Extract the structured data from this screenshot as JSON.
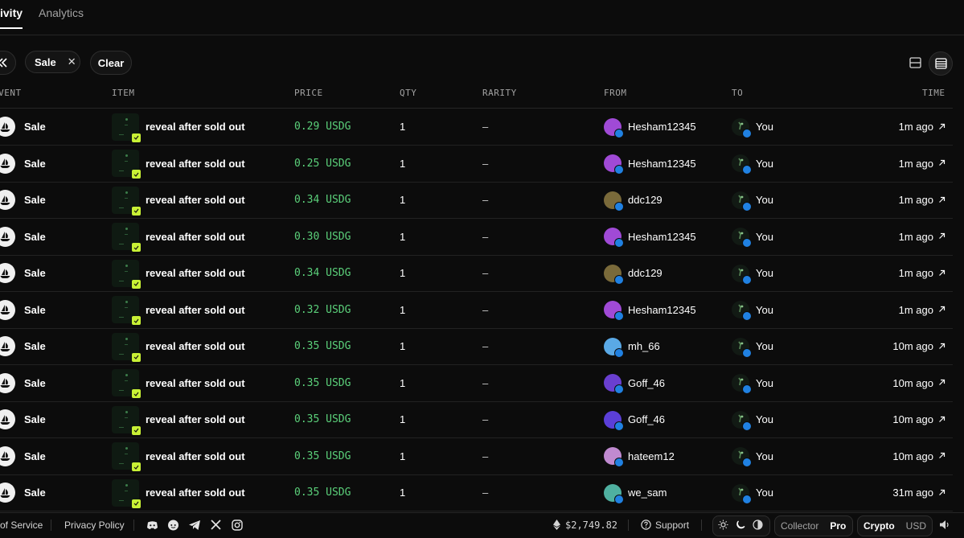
{
  "tabs": [
    {
      "label": "ivity",
      "active": true
    },
    {
      "label": "Analytics",
      "active": false
    }
  ],
  "filters": {
    "collapse_icon": "double-chevron-left-icon",
    "active_filter": "Sale",
    "clear_label": "Clear",
    "views": [
      "list-view-icon",
      "table-view-icon"
    ]
  },
  "columns": {
    "event": "EVENT",
    "item": "ITEM",
    "price": "PRICE",
    "qty": "QTY",
    "rarity": "RARITY",
    "from": "FROM",
    "to": "TO",
    "time": "TIME"
  },
  "rows": [
    {
      "event": "Sale",
      "item": "reveal after sold out",
      "price": "0.29 USDG",
      "qty": "1",
      "rarity": "–",
      "from": "Hesham12345",
      "from_color": "#a04ad6",
      "to": "You",
      "time": "1m ago"
    },
    {
      "event": "Sale",
      "item": "reveal after sold out",
      "price": "0.25 USDG",
      "qty": "1",
      "rarity": "–",
      "from": "Hesham12345",
      "from_color": "#a04ad6",
      "to": "You",
      "time": "1m ago"
    },
    {
      "event": "Sale",
      "item": "reveal after sold out",
      "price": "0.34 USDG",
      "qty": "1",
      "rarity": "–",
      "from": "ddc129",
      "from_color": "#7a6a3a",
      "to": "You",
      "time": "1m ago"
    },
    {
      "event": "Sale",
      "item": "reveal after sold out",
      "price": "0.30 USDG",
      "qty": "1",
      "rarity": "–",
      "from": "Hesham12345",
      "from_color": "#a04ad6",
      "to": "You",
      "time": "1m ago"
    },
    {
      "event": "Sale",
      "item": "reveal after sold out",
      "price": "0.34 USDG",
      "qty": "1",
      "rarity": "–",
      "from": "ddc129",
      "from_color": "#7a6a3a",
      "to": "You",
      "time": "1m ago"
    },
    {
      "event": "Sale",
      "item": "reveal after sold out",
      "price": "0.32 USDG",
      "qty": "1",
      "rarity": "–",
      "from": "Hesham12345",
      "from_color": "#a04ad6",
      "to": "You",
      "time": "1m ago"
    },
    {
      "event": "Sale",
      "item": "reveal after sold out",
      "price": "0.35 USDG",
      "qty": "1",
      "rarity": "–",
      "from": "mh_66",
      "from_color": "#5aa9e6",
      "to": "You",
      "time": "10m ago"
    },
    {
      "event": "Sale",
      "item": "reveal after sold out",
      "price": "0.35 USDG",
      "qty": "1",
      "rarity": "–",
      "from": "Goff_46",
      "from_color": "#6a3fd0",
      "to": "You",
      "time": "10m ago"
    },
    {
      "event": "Sale",
      "item": "reveal after sold out",
      "price": "0.35 USDG",
      "qty": "1",
      "rarity": "–",
      "from": "Goff_46",
      "from_color": "#5b3fd8",
      "to": "You",
      "time": "10m ago"
    },
    {
      "event": "Sale",
      "item": "reveal after sold out",
      "price": "0.35 USDG",
      "qty": "1",
      "rarity": "–",
      "from": "hateem12",
      "from_color": "#c08ad0",
      "to": "You",
      "time": "10m ago"
    },
    {
      "event": "Sale",
      "item": "reveal after sold out",
      "price": "0.35 USDG",
      "qty": "1",
      "rarity": "–",
      "from": "we_sam",
      "from_color": "#4fb0a0",
      "to": "You",
      "time": "31m ago"
    }
  ],
  "footer": {
    "terms": "of Service",
    "privacy": "Privacy Policy",
    "social_icons": [
      "discord-icon",
      "reddit-icon",
      "telegram-icon",
      "x-icon",
      "instagram-icon"
    ],
    "eth_price": "$2,749.82",
    "support": "Support",
    "theme_icons": [
      "sun-icon",
      "moon-icon",
      "contrast-icon"
    ],
    "mode_options": [
      "Collector",
      "Pro"
    ],
    "mode_selected": "Pro",
    "currency_options": [
      "Crypto",
      "USD"
    ],
    "currency_selected": "Crypto",
    "sound_icon": "speaker-icon"
  },
  "colors": {
    "background": "#0c0c0c",
    "price_green": "#5bd07a",
    "verified_blue": "#2081e2",
    "item_badge": "#c8f135"
  }
}
